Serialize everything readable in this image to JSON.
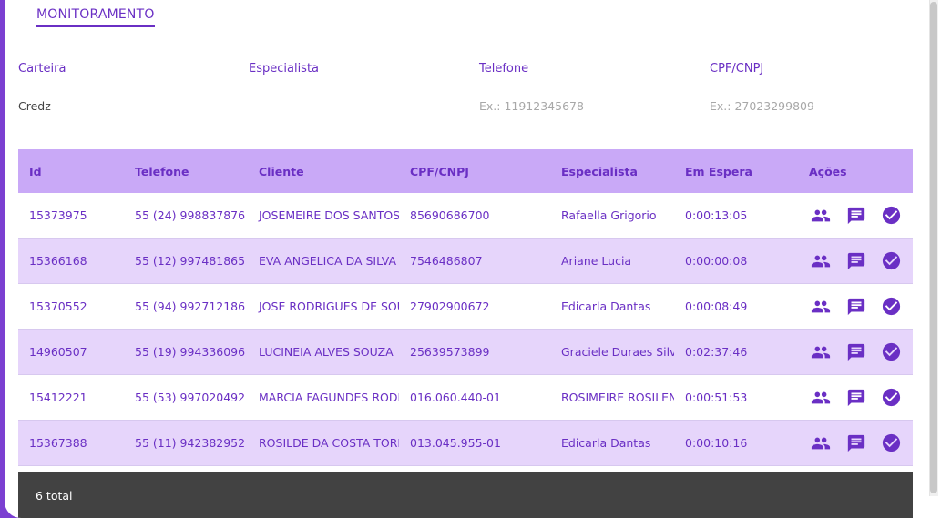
{
  "tab": {
    "label": "MONITORAMENTO"
  },
  "filters": [
    {
      "label": "Carteira",
      "value": "Credz",
      "placeholder": ""
    },
    {
      "label": "Especialista",
      "value": "",
      "placeholder": ""
    },
    {
      "label": "Telefone",
      "value": "",
      "placeholder": "Ex.: 11912345678"
    },
    {
      "label": "CPF/CNPJ",
      "value": "",
      "placeholder": "Ex.: 27023299809"
    }
  ],
  "table": {
    "columns": [
      "Id",
      "Telefone",
      "Cliente",
      "CPF/CNPJ",
      "Especialista",
      "Em Espera",
      "Ações"
    ],
    "rows": [
      {
        "id": "15373975",
        "telefone": "55 (24) 998837876",
        "cliente": "JOSEMEIRE DOS SANTOS M",
        "cpf": "85690686700",
        "especialista": "Rafaella Grigorio",
        "espera": "0:00:13:05"
      },
      {
        "id": "15366168",
        "telefone": "55 (12) 997481865",
        "cliente": "EVA ANGELICA DA SILVA",
        "cpf": "7546486807",
        "especialista": "Ariane Lucia",
        "espera": "0:00:00:08"
      },
      {
        "id": "15370552",
        "telefone": "55 (94) 992712186",
        "cliente": "JOSE RODRIGUES DE SOUS",
        "cpf": "27902900672",
        "especialista": "Edicarla Dantas",
        "espera": "0:00:08:49"
      },
      {
        "id": "14960507",
        "telefone": "55 (19) 994336096",
        "cliente": "LUCINEIA ALVES SOUZA",
        "cpf": "25639573899",
        "especialista": "Graciele Duraes Silva I",
        "espera": "0:02:37:46"
      },
      {
        "id": "15412221",
        "telefone": "55 (53) 997020492",
        "cliente": "MARCIA FAGUNDES RODR",
        "cpf": "016.060.440-01",
        "especialista": "ROSIMEIRE ROSILENE",
        "espera": "0:00:51:53"
      },
      {
        "id": "15367388",
        "telefone": "55 (11) 942382952",
        "cliente": "ROSILDE DA COSTA TORRE",
        "cpf": "013.045.955-01",
        "especialista": "Edicarla Dantas",
        "espera": "0:00:10:16"
      }
    ]
  },
  "footer": {
    "total_label": "6 total"
  },
  "icons": {
    "transfer": "people-icon",
    "chat": "chat-icon",
    "finish": "check-circle-icon"
  },
  "colors": {
    "accent": "#6a2fc4",
    "header_bg": "#c9a9f7",
    "row_alt": "#e6d5fb",
    "footer_bg": "#424242"
  }
}
